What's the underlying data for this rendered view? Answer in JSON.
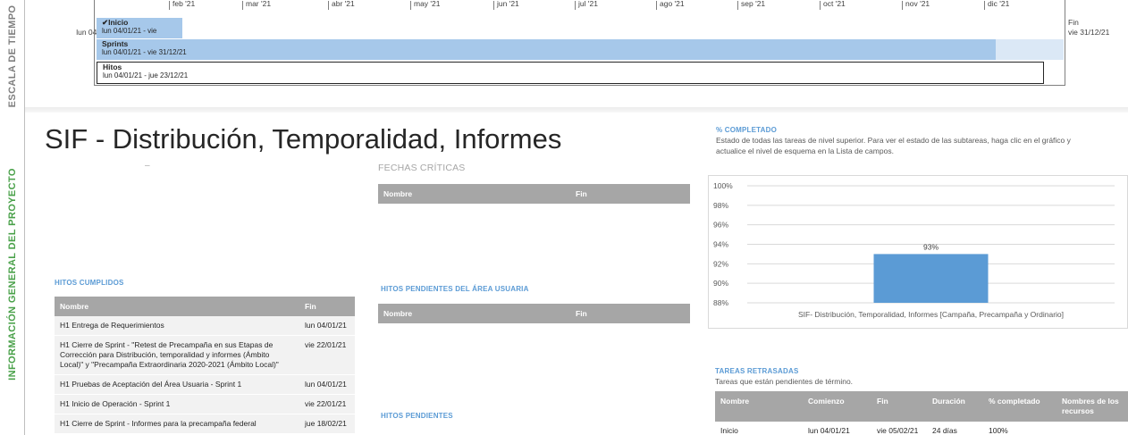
{
  "timeline": {
    "side_label": "ESCALA DE TIEMPO",
    "start": {
      "label": "Inicio",
      "date": "lun 04/01/21"
    },
    "end": {
      "label": "Fin",
      "date": "vie 31/12/21"
    },
    "months": [
      "feb '21",
      "mar '21",
      "abr '21",
      "may '21",
      "jun '21",
      "jul '21",
      "ago '21",
      "sep '21",
      "oct '21",
      "nov '21",
      "dic '21"
    ],
    "bars": {
      "inicio": {
        "name": "Inicio",
        "dates": "lun 04/01/21 - vie"
      },
      "sprints": {
        "name": "Sprints",
        "dates": "lun 04/01/21 - vie 31/12/21"
      },
      "hitos": {
        "name": "Hitos",
        "dates": "lun 04/01/21 - jue 23/12/21"
      }
    }
  },
  "info": {
    "side_label": "INFORMACIÓN GENERAL DEL PROYECTO",
    "title": "SIF - Distribución, Temporalidad, Informes",
    "dash": "–"
  },
  "fechas_criticas": {
    "heading": "FECHAS CRÍTICAS",
    "columns": [
      "Nombre",
      "Fin"
    ]
  },
  "hitos_pendientes_usuaria": {
    "heading": "HITOS PENDIENTES DEL ÁREA USUARIA",
    "columns": [
      "Nombre",
      "Fin"
    ]
  },
  "hitos_pendientes": {
    "heading": "HITOS PENDIENTES"
  },
  "hitos_cumplidos": {
    "heading": "HITOS CUMPLIDOS",
    "columns": [
      "Nombre",
      "Fin"
    ],
    "rows": [
      {
        "nombre": "H1 Entrega de Requerimientos",
        "fin": "lun 04/01/21"
      },
      {
        "nombre": "H1 Cierre de Sprint - \"Retest de Precampaña en sus Etapas de Corrección para Distribución, temporalidad y informes (Ámbito Local)\" y \"Precampaña Extraordinaria 2020-2021 (Ámbito Local)\"",
        "fin": "vie 22/01/21"
      },
      {
        "nombre": "H1 Pruebas de Aceptación del Área Usuaria - Sprint 1",
        "fin": "lun 04/01/21"
      },
      {
        "nombre": "H1 Inicio de Operación - Sprint 1",
        "fin": "vie 22/01/21"
      },
      {
        "nombre": "H1 Cierre de Sprint - Informes para la precampaña federal",
        "fin": "jue 18/02/21"
      }
    ]
  },
  "completado": {
    "heading": "% COMPLETADO",
    "description": "Estado de todas las tareas de nivel superior. Para ver el estado de las subtareas, haga clic en el gráfico y actualice el nivel de esquema en la Lista de campos."
  },
  "chart_data": {
    "type": "bar",
    "categories": [
      "SIF- Distribución, Temporalidad, Informes [Campaña, Precampaña y Ordinario]"
    ],
    "values": [
      93
    ],
    "data_labels": [
      "93%"
    ],
    "ylim": [
      88,
      100
    ],
    "yticks": [
      "88%",
      "90%",
      "92%",
      "94%",
      "96%",
      "98%",
      "100%"
    ],
    "grid": true,
    "bar_color": "#5b9bd5"
  },
  "tareas_retrasadas": {
    "heading": "TAREAS RETRASADAS",
    "description": "Tareas que están pendientes de término.",
    "columns": [
      "Nombre",
      "Comienzo",
      "Fin",
      "Duración",
      "% completado",
      "Nombres de los recursos"
    ],
    "rows": [
      {
        "nombre": "Inicio",
        "comienzo": "lun 04/01/21",
        "fin": "vie 05/02/21",
        "duracion": "24 días",
        "completado": "100%",
        "recursos": ""
      }
    ]
  },
  "colors": {
    "accent": "#5b9bd5",
    "header_gray": "#a6a6a6",
    "side_green": "#4aa14a",
    "timeline_bar": "#a6c8ea"
  }
}
